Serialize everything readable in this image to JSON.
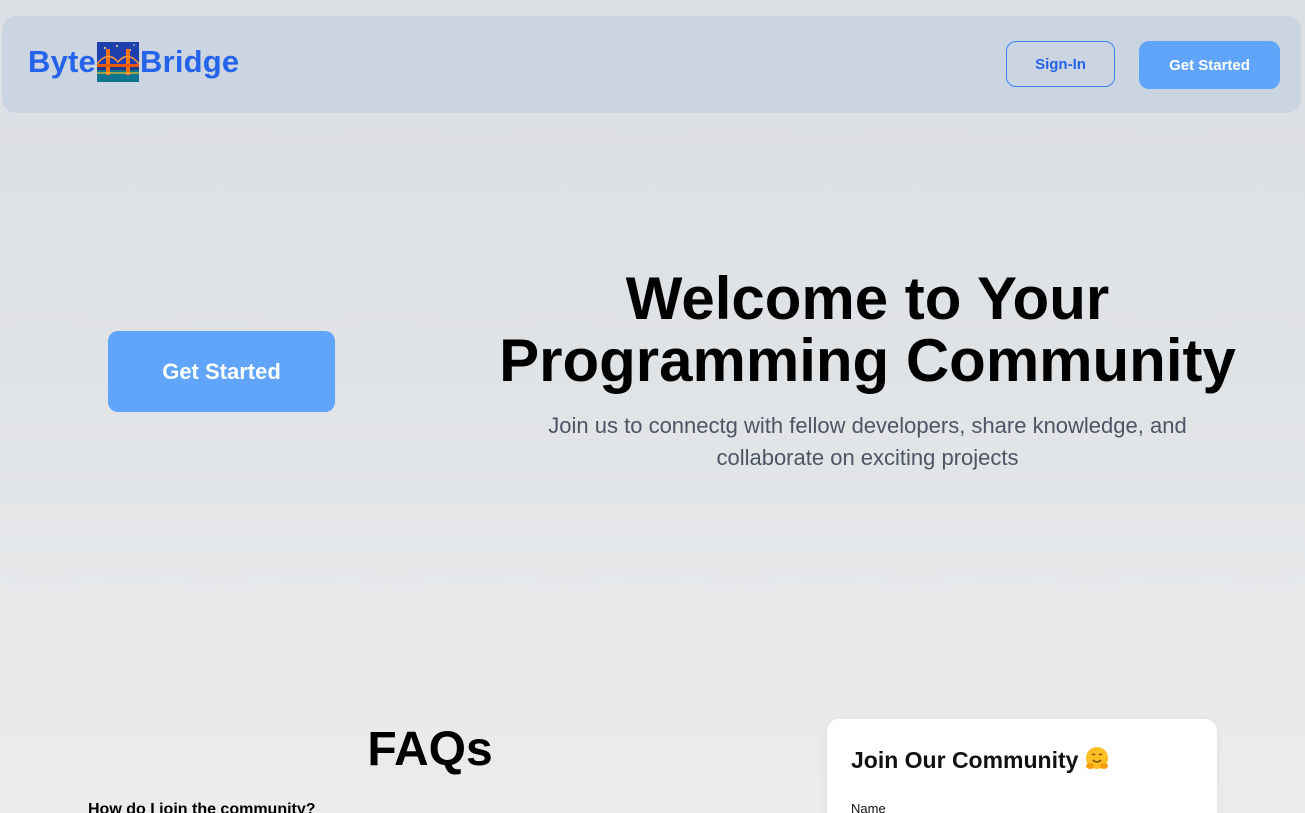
{
  "navbar": {
    "brand_left": "Byte",
    "brand_logo_icon": "golden-gate-bridge-icon",
    "brand_right": "Bridge",
    "signin_label": "Sign-In",
    "get_started_label": "Get Started"
  },
  "hero": {
    "cta_label": "Get Started",
    "title_line1": "Welcome to Your",
    "title_line2": "Programming Community",
    "subtitle_line1": "Join us to connectg with fellow developers, share knowledge, and",
    "subtitle_line2": "collaborate on exciting projects"
  },
  "faq": {
    "title": "FAQs",
    "items": [
      {
        "question": "How do I join the community?"
      }
    ]
  },
  "join_card": {
    "title": "Join Our Community",
    "emoji_icon": "hugging-face-emoji-icon",
    "name_label": "Name"
  },
  "colors": {
    "brand": "#2563eb",
    "primary_button": "#60a5fa",
    "navbar_bg": "#cbd5e1"
  }
}
